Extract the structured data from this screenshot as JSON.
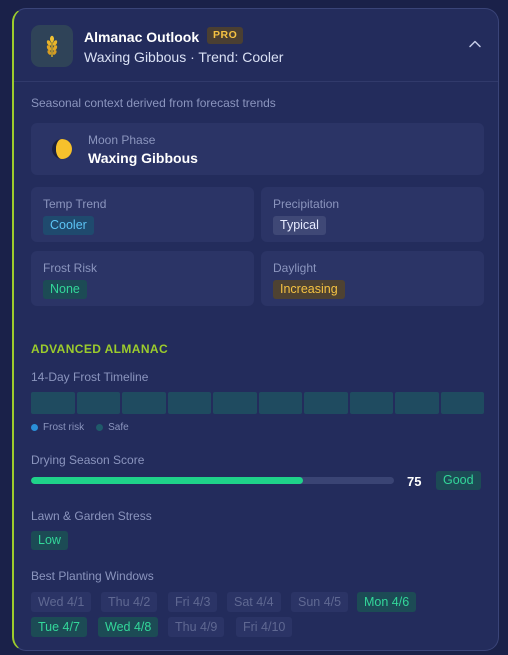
{
  "header": {
    "title": "Almanac Outlook",
    "pro_badge": "PRO",
    "subtitle": "Waxing Gibbous · Trend: Cooler",
    "collapse_icon": "chevron-up-icon",
    "logo_icon": "wheat-icon"
  },
  "context_text": "Seasonal context derived from forecast trends",
  "moon": {
    "label": "Moon Phase",
    "value": "Waxing Gibbous",
    "icon": "moon-icon"
  },
  "tiles": [
    {
      "label": "Temp Trend",
      "value": "Cooler",
      "tone": "blue"
    },
    {
      "label": "Precipitation",
      "value": "Typical",
      "tone": "gray"
    },
    {
      "label": "Frost Risk",
      "value": "None",
      "tone": "green"
    },
    {
      "label": "Daylight",
      "value": "Increasing",
      "tone": "amber"
    }
  ],
  "advanced": {
    "title": "ADVANCED ALMANAC",
    "frost_timeline": {
      "title": "14-Day Frost Timeline",
      "days_visible": 10,
      "frost_days": 0,
      "legend": {
        "frost": "Frost risk",
        "safe": "Safe"
      }
    },
    "drying": {
      "title": "Drying Season Score",
      "score": "75",
      "score_fraction": 0.75,
      "rating": "Good"
    },
    "lawn": {
      "title": "Lawn & Garden Stress",
      "value": "Low"
    },
    "planting": {
      "title": "Best Planting Windows",
      "days": [
        {
          "label": "Wed 4/1",
          "good": false
        },
        {
          "label": "Thu 4/2",
          "good": false
        },
        {
          "label": "Fri 4/3",
          "good": false
        },
        {
          "label": "Sat 4/4",
          "good": false
        },
        {
          "label": "Sun 4/5",
          "good": false
        },
        {
          "label": "Mon 4/6",
          "good": true
        },
        {
          "label": "Tue 4/7",
          "good": true
        },
        {
          "label": "Wed 4/8",
          "good": true
        },
        {
          "label": "Thu 4/9",
          "good": false
        },
        {
          "label": "Fri 4/10",
          "good": false
        }
      ]
    }
  },
  "colors": {
    "accent": "#9ccc2c",
    "good": "#1fd28a",
    "pro": "#f5c242"
  }
}
